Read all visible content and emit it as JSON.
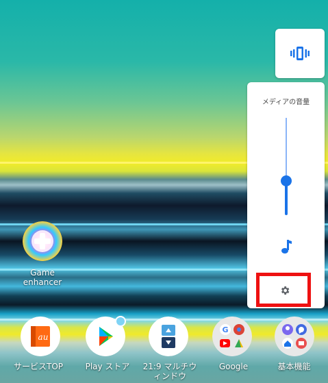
{
  "volume_panel": {
    "title": "メディアの音量",
    "media_level": 0.35
  },
  "desktop_icons": {
    "game_enhancer": "Game\nenhancer"
  },
  "dock": {
    "apps": [
      {
        "label": "サービスTOP",
        "icon": "au-service-icon"
      },
      {
        "label": "Play ストア",
        "icon": "play-store-icon"
      },
      {
        "label": "21:9 マルチウ\nィンドウ",
        "icon": "multi-window-icon"
      },
      {
        "label": "Google",
        "icon": "google-folder-icon"
      },
      {
        "label": "基本機能",
        "icon": "basic-functions-folder-icon"
      }
    ]
  },
  "colors": {
    "accent_blue": "#1a73e8",
    "highlight_red": "#ee1111"
  }
}
